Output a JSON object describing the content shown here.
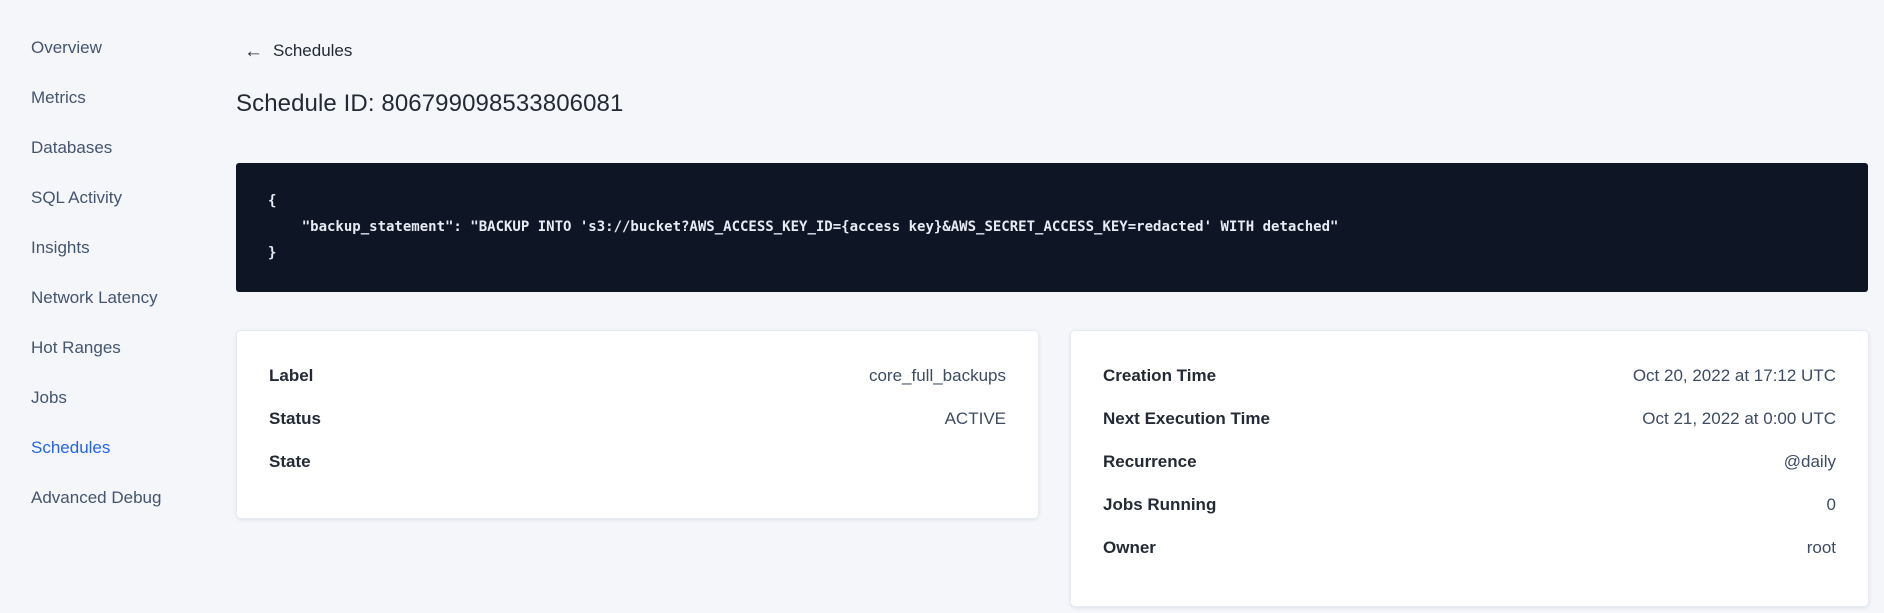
{
  "colors": {
    "page_bg": "#f4f6fa",
    "accent_blue": "#2563eb",
    "code_bg": "#0e1524",
    "code_text": "#e7ecf4",
    "card_bg": "#ffffff"
  },
  "icons": {
    "back_arrow": "←"
  },
  "sidebar": {
    "items": [
      {
        "label": "Overview",
        "active": false
      },
      {
        "label": "Metrics",
        "active": false
      },
      {
        "label": "Databases",
        "active": false
      },
      {
        "label": "SQL Activity",
        "active": false
      },
      {
        "label": "Insights",
        "active": false
      },
      {
        "label": "Network Latency",
        "active": false
      },
      {
        "label": "Hot Ranges",
        "active": false
      },
      {
        "label": "Jobs",
        "active": false
      },
      {
        "label": "Schedules",
        "active": true
      },
      {
        "label": "Advanced Debug",
        "active": false
      }
    ]
  },
  "main": {
    "back_link_label": "Schedules",
    "page_title": "Schedule ID: 806799098533806081",
    "code_block": {
      "text": "{\n    \"backup_statement\": \"BACKUP INTO 's3://bucket?AWS_ACCESS_KEY_ID={access key}&AWS_SECRET_ACCESS_KEY=redacted' WITH detached\"\n}"
    },
    "details_card": {
      "rows": [
        {
          "label": "Label",
          "value": "core_full_backups"
        },
        {
          "label": "Status",
          "value": "ACTIVE"
        },
        {
          "label": "State",
          "value": ""
        }
      ]
    },
    "schedule_card": {
      "rows": [
        {
          "label": "Creation Time",
          "value": "Oct 20, 2022 at 17:12 UTC"
        },
        {
          "label": "Next Execution Time",
          "value": "Oct 21, 2022 at 0:00 UTC"
        },
        {
          "label": "Recurrence",
          "value": "@daily"
        },
        {
          "label": "Jobs Running",
          "value": "0"
        },
        {
          "label": "Owner",
          "value": "root"
        }
      ]
    }
  }
}
